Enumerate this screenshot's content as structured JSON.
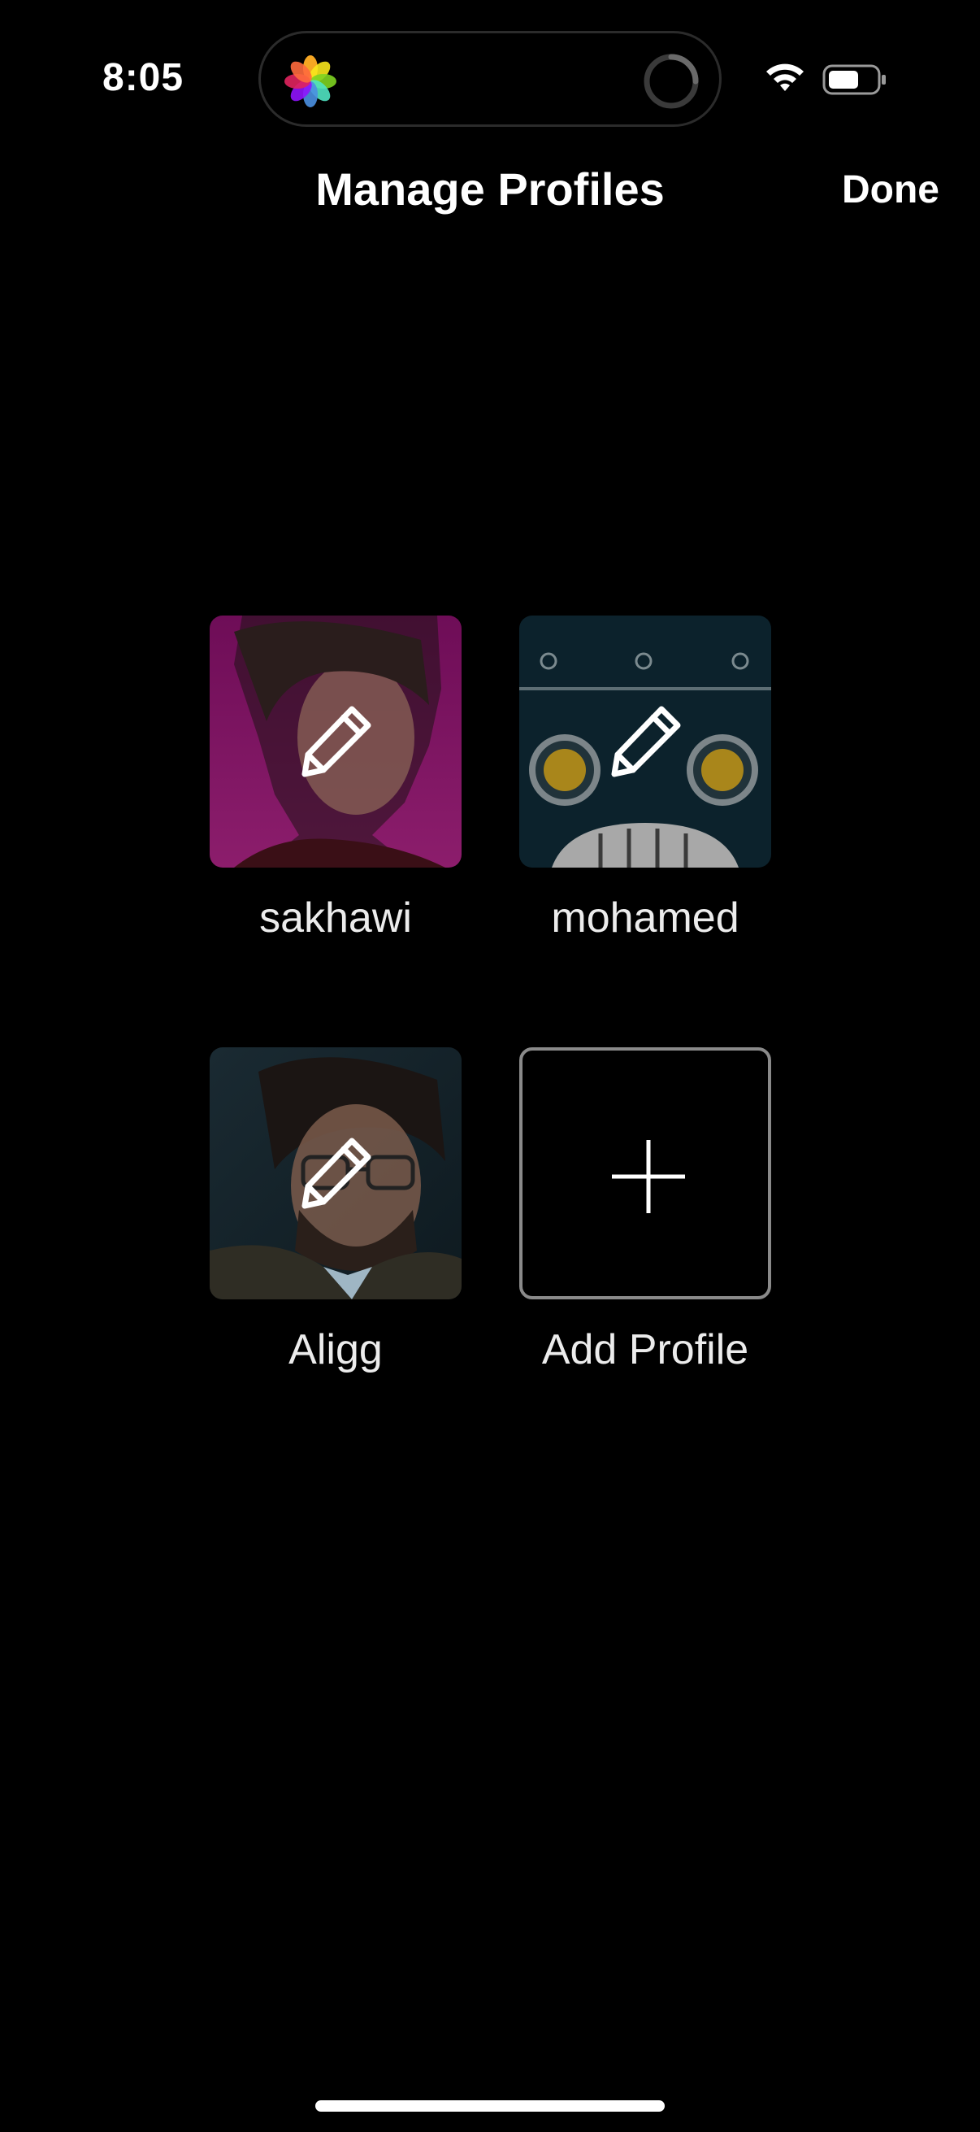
{
  "status_bar": {
    "time": "8:05",
    "icons": [
      "photos-icon",
      "loading-spinner-icon",
      "wifi-icon",
      "battery-icon"
    ]
  },
  "header": {
    "title": "Manage Profiles",
    "done_label": "Done"
  },
  "profiles": [
    {
      "name": "sakhawi",
      "avatar": "woman-portrait-avatar",
      "accent": "#8a1a6a"
    },
    {
      "name": "mohamed",
      "avatar": "robot-face-avatar",
      "accent": "#0d2530"
    },
    {
      "name": "Aligg",
      "avatar": "man-glasses-portrait-avatar",
      "accent": "#17252c"
    }
  ],
  "add_profile": {
    "label": "Add Profile"
  },
  "colors": {
    "background": "#000000",
    "text": "#ffffff",
    "add_border": "#8a8a8a"
  }
}
